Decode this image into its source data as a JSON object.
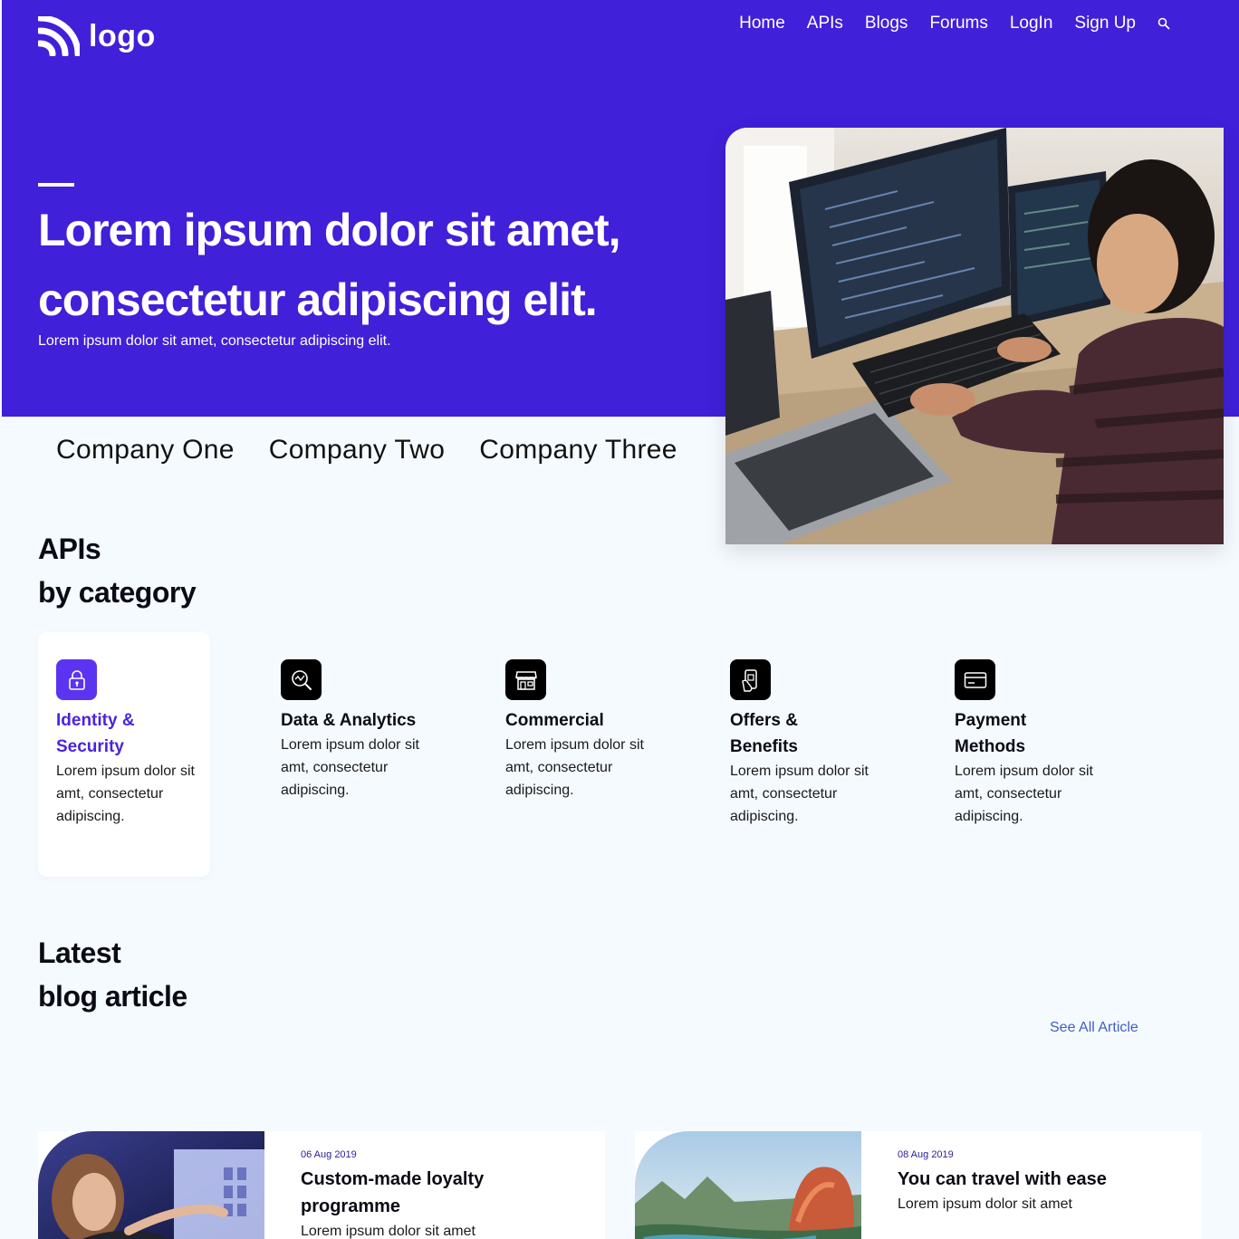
{
  "brand": {
    "logo_text": "logo"
  },
  "nav": {
    "items": [
      "Home",
      "APIs",
      "Blogs",
      "Forums",
      "LogIn",
      "Sign Up"
    ],
    "search_icon": "search-icon"
  },
  "hero": {
    "title_line1": "Lorem ipsum dolor sit amet,",
    "title_line2": "consectetur adipiscing elit.",
    "subtitle": "Lorem ipsum dolor sit amet, consectetur adipiscing elit."
  },
  "companies": [
    "Company One",
    "Company Two",
    "Company Three"
  ],
  "apis_section": {
    "title_line1": "APIs",
    "title_line2": "by category",
    "categories": [
      {
        "title": "Identity & Security",
        "icon": "lock-icon",
        "desc": "Lorem ipsum dolor sit amt, consectetur adipiscing.",
        "active": true
      },
      {
        "title": "Data & Analytics",
        "icon": "magnifier-chart-icon",
        "desc": "Lorem ipsum dolor sit amt, consectetur adipiscing.",
        "active": false
      },
      {
        "title": "Commercial",
        "icon": "storefront-icon",
        "desc": "Lorem ipsum dolor sit amt, consectetur adipiscing.",
        "active": false
      },
      {
        "title": "Offers & Benefits",
        "icon": "mobile-offer-icon",
        "desc": "Lorem ipsum dolor sit amt, consectetur adipiscing.",
        "active": false
      },
      {
        "title": "Payment Methods",
        "icon": "credit-card-icon",
        "desc": "Lorem ipsum dolor sit amt, consectetur adipiscing.",
        "active": false
      }
    ]
  },
  "blog_section": {
    "title_line1": "Latest",
    "title_line2": "blog article",
    "see_all": "See All Article",
    "articles": [
      {
        "date": "06 Aug 2019",
        "title": "Custom-made loyalty programme",
        "excerpt": "Lorem ipsum dolor sit amet"
      },
      {
        "date": "08 Aug 2019",
        "title": "You can travel with ease",
        "excerpt": "Lorem ipsum dolor sit amet"
      }
    ]
  },
  "colors": {
    "hero_bg": "#4020d8",
    "accent": "#5b34f2",
    "active_title": "#4a24df",
    "link": "#3f5fc4",
    "page_bg": "#f5faff"
  }
}
